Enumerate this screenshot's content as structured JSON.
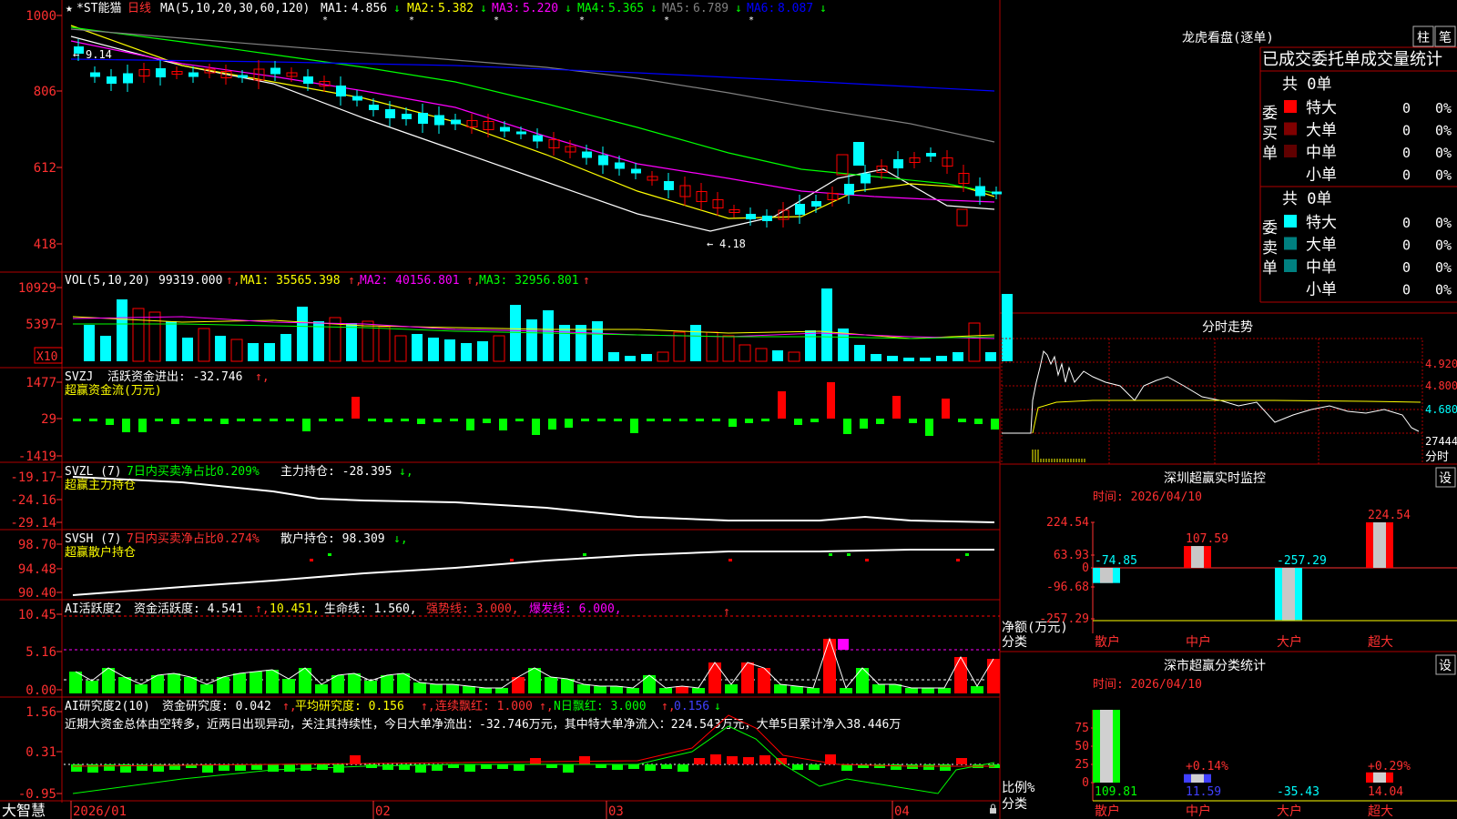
{
  "stock": {
    "title": "*ST能猫",
    "period": "日线"
  },
  "colors": {
    "up": "#ff0000",
    "down": "#00ffff",
    "ma1": "#ffffff",
    "ma2": "#ffff00",
    "ma3": "#ff00ff",
    "ma4": "#00ff00",
    "ma5": "#808080",
    "ma6": "#0000ff",
    "frame": "#b00000"
  },
  "main_panel": {
    "ma_label": "MA(5,10,20,30,60,120)",
    "ma": [
      {
        "label": "MA1:",
        "value": "4.856",
        "arrow": "↓"
      },
      {
        "label": "MA2:",
        "value": "5.382",
        "arrow": "↓"
      },
      {
        "label": "MA3:",
        "value": "5.220",
        "arrow": "↓"
      },
      {
        "label": "MA4:",
        "value": "5.365",
        "arrow": "↓"
      },
      {
        "label": "MA5:",
        "value": "6.789",
        "arrow": "↓"
      },
      {
        "label": "MA6:",
        "value": "8.087",
        "arrow": "↓"
      }
    ],
    "yticks": [
      "1000",
      "806",
      "612",
      "418"
    ],
    "high_label": "9.14",
    "low_label": "4.18"
  },
  "vol_panel": {
    "label": "VOL(5,10,20)",
    "value": "99319.000",
    "ma1": "MA1: 35565.398",
    "ma2": "MA2: 40156.801",
    "ma3": "MA3: 32956.801",
    "yticks": [
      "10929",
      "5397"
    ],
    "unit": "X10"
  },
  "svzj_panel": {
    "label": "SVZJ",
    "text": "活跃资金进出: -32.746",
    "sub": "超赢资金流(万元)",
    "yticks": [
      "1477",
      "29",
      "-1419"
    ]
  },
  "svzl_panel": {
    "label": "SVZL (7)",
    "text1": "7日内买卖净占比0.209%",
    "text2": "主力持仓: -28.395",
    "sub": "超赢主力持仓",
    "yticks": [
      "-19.17",
      "-24.16",
      "-29.14"
    ]
  },
  "svsh_panel": {
    "label": "SVSH (7)",
    "text1": "7日内买卖净占比0.274%",
    "text2": "散户持仓: 98.309",
    "sub": "超赢散户持仓",
    "yticks": [
      "98.70",
      "94.48",
      "90.40"
    ]
  },
  "ai_panel": {
    "label": "AI活跃度2",
    "text1": "资金活跃度: 4.541",
    "text2": "10.451,",
    "text3": "生命线: 1.560,",
    "text4": "强势线: 3.000,",
    "text5": "爆发线: 6.000,",
    "yticks": [
      "10.45",
      "5.16",
      "0.00"
    ]
  },
  "ai2_panel": {
    "label": "AI研究度2(10)",
    "text1": "资金研究度: 0.042",
    "text2": "平均研究度: 0.156",
    "text3": "连续飘红: 1.000",
    "text4": "N日飘红: 3.000",
    "text5": "0.156",
    "comment": "近期大资金总体由空转多，近两日出现异动，关注其持续性，今日大单净流出：-32.746万元，其中特大单净流入：224.543万元，大单5日累计净入38.446万",
    "yticks": [
      "1.56",
      "0.31",
      "-0.95"
    ]
  },
  "xaxis": {
    "labels": [
      "2026/01",
      "02",
      "03",
      "04"
    ]
  },
  "brand": "大智慧",
  "right": {
    "dragon_title": "龙虎看盘(逐单)",
    "btn_zhu": "柱",
    "btn_pen": "笔",
    "table_title": "已成交委托单成交量统计",
    "buy": {
      "side": "委买单",
      "total": "共 0单",
      "rows": [
        {
          "name": "特大",
          "vol": "0",
          "pct": "0%",
          "color": "#ff0000"
        },
        {
          "name": "大单",
          "vol": "0",
          "pct": "0%",
          "color": "#800000"
        },
        {
          "name": "中单",
          "vol": "0",
          "pct": "0%",
          "color": "#600000"
        },
        {
          "name": "小单",
          "vol": "0",
          "pct": "0%",
          "color": ""
        }
      ]
    },
    "sell": {
      "side": "委卖单",
      "total": "共 0单",
      "rows": [
        {
          "name": "特大",
          "vol": "0",
          "pct": "0%",
          "color": "#00ffff"
        },
        {
          "name": "大单",
          "vol": "0",
          "pct": "0%",
          "color": "#008080"
        },
        {
          "name": "中单",
          "vol": "0",
          "pct": "0%",
          "color": "#008080"
        },
        {
          "name": "小单",
          "vol": "0",
          "pct": "0%",
          "color": ""
        }
      ]
    },
    "intraday": {
      "title": "分时走势",
      "yticks": [
        "4.920",
        "4.800",
        "4.680"
      ],
      "vol_label": "27444",
      "unit": "分时"
    },
    "realtime": {
      "title": "深圳超赢实时监控",
      "btn": "设",
      "time": "时间: 2026/04/10",
      "yticks": [
        "224.54",
        "63.93",
        "0",
        "-96.68",
        "-257.29"
      ],
      "ylabel": "净额(万元)",
      "xlabel": "分类",
      "chart_data": {
        "type": "bar",
        "categories": [
          "散户",
          "中户",
          "大户",
          "超大"
        ],
        "values": [
          -74.85,
          107.59,
          -257.29,
          224.54
        ],
        "ylim": [
          -257.29,
          224.54
        ]
      }
    },
    "classify": {
      "title": "深市超赢分类统计",
      "btn": "设",
      "time": "时间: 2026/04/10",
      "yticks": [
        "75",
        "50",
        "25",
        "0"
      ],
      "ylabel": "比例%",
      "xlabel": "分类",
      "chart_data": {
        "type": "bar",
        "categories": [
          "散户",
          "中户",
          "大户",
          "超大"
        ],
        "values": [
          109.81,
          11.59,
          -35.43,
          14.04
        ],
        "pct": [
          "",
          "+0.14%",
          "",
          "+0.29%"
        ]
      }
    }
  }
}
